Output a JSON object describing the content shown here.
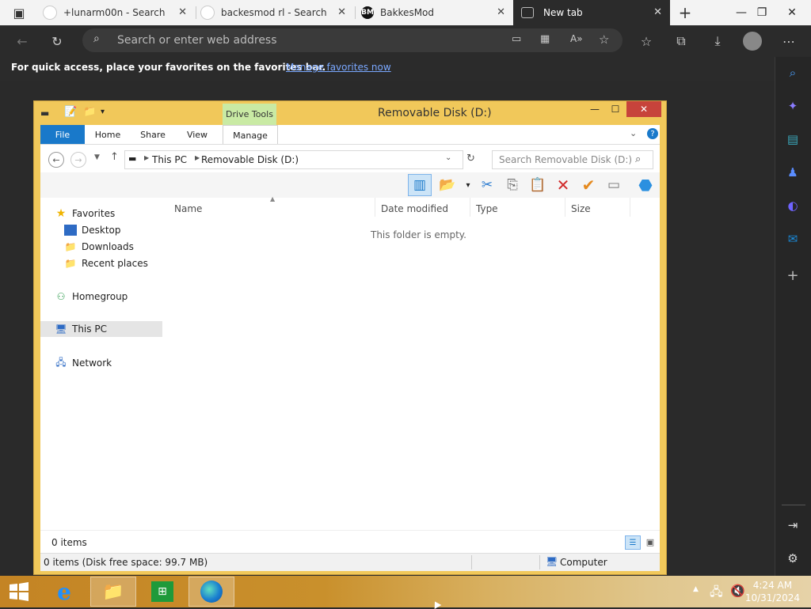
{
  "browser": {
    "tabs": [
      {
        "label": "+lunarm00n - Search",
        "icon": "search-favicon"
      },
      {
        "label": "backesmod rl - Search",
        "icon": "search-favicon"
      },
      {
        "label": "BakkesMod",
        "icon": "bakkesmod-favicon",
        "icon_text": "BM"
      },
      {
        "label": "New tab",
        "icon": "newtab-favicon",
        "active": true
      }
    ],
    "address_placeholder": "Search or enter web address",
    "favorites_bar": {
      "message": "For quick access, place your favorites on the favorites bar.",
      "link": "Manage favorites now"
    }
  },
  "explorer": {
    "title": "Removable Disk (D:)",
    "context_tab": "Drive Tools",
    "ribbon_tabs": [
      "File",
      "Home",
      "Share",
      "View",
      "Manage"
    ],
    "breadcrumb": [
      "This PC",
      "Removable Disk (D:)"
    ],
    "search_placeholder": "Search Removable Disk (D:)",
    "nav_pane": {
      "favorites": {
        "label": "Favorites",
        "items": [
          "Desktop",
          "Downloads",
          "Recent places"
        ]
      },
      "homegroup": "Homegroup",
      "this_pc": "This PC",
      "network": "Network"
    },
    "columns": [
      "Name",
      "Date modified",
      "Type",
      "Size"
    ],
    "empty_message": "This folder is empty.",
    "status_items": "0 items",
    "details_left": "0 items (Disk free space: 99.7 MB)",
    "details_right": "Computer"
  },
  "taskbar": {
    "time": "4:24 AM",
    "date": "10/31/2024"
  },
  "colors": {
    "browser_dark": "#2b2b2b",
    "explorer_frame": "#f1c85a",
    "file_tab": "#1979ca",
    "close_button": "#c7433b",
    "drive_tools": "#c9eaa4"
  }
}
